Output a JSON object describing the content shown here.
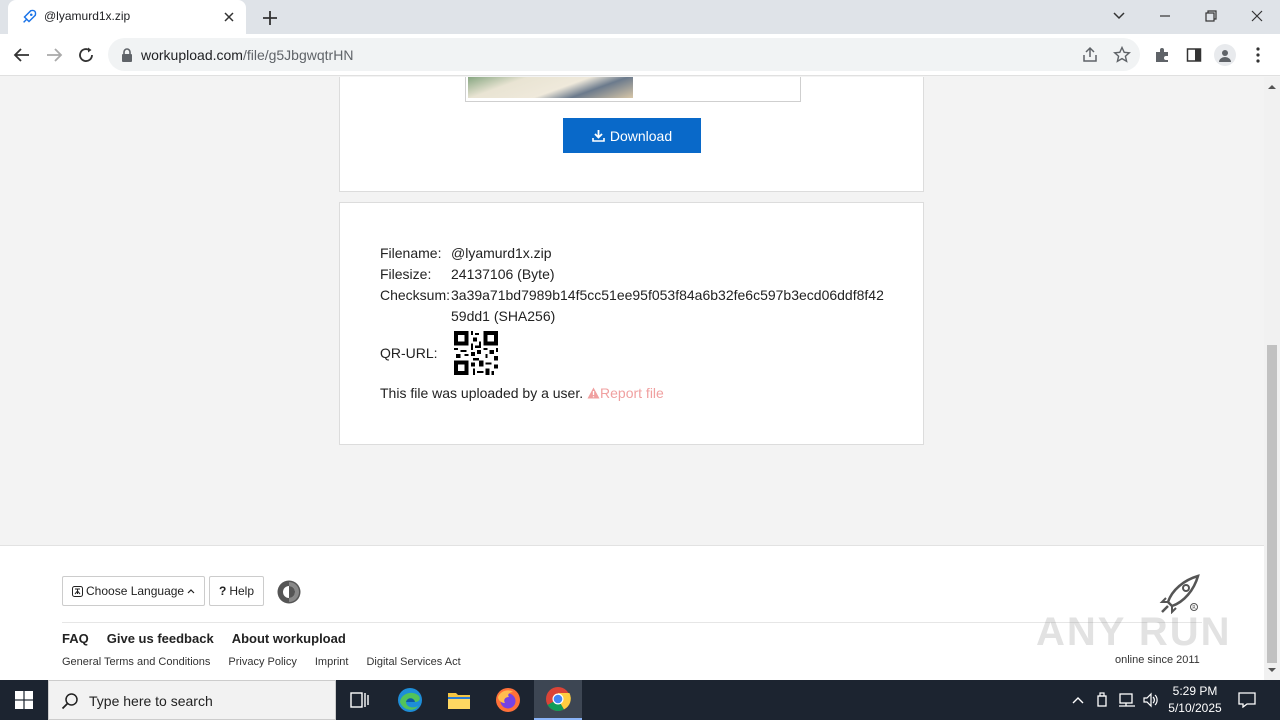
{
  "browser": {
    "tab_title": "@lyamurd1x.zip",
    "url_host": "workupload.com",
    "url_path": "/file/g5JbgwqtrHN"
  },
  "page": {
    "download_label": "Download",
    "file_info": {
      "filename_label": "Filename:",
      "filename": "@lyamurd1x.zip",
      "filesize_label": "Filesize:",
      "filesize": "24137106 (Byte)",
      "checksum_label": "Checksum:",
      "checksum": "3a39a71bd7989b14f5cc51ee95f053f84a6b32fe6c597b3ecd06ddf8f4259dd1 (SHA256)",
      "qr_label": "QR-URL:",
      "uploaded_text": "This file was uploaded by a user.",
      "report_label": "Report file"
    }
  },
  "footer": {
    "language_label": "Choose Language",
    "help_label": "Help",
    "links_primary": [
      "FAQ",
      "Give us feedback",
      "About workupload"
    ],
    "links_secondary": [
      "General Terms and Conditions",
      "Privacy Policy",
      "Imprint",
      "Digital Services Act"
    ],
    "online_since": "online since 2011",
    "watermark": "ANY RUN"
  },
  "taskbar": {
    "search_placeholder": "Type here to search",
    "time": "5:29 PM",
    "date": "5/10/2025"
  },
  "colors": {
    "download_button": "#0969c9",
    "report_link": "#f0a0a0",
    "taskbar": "#1c2430"
  }
}
